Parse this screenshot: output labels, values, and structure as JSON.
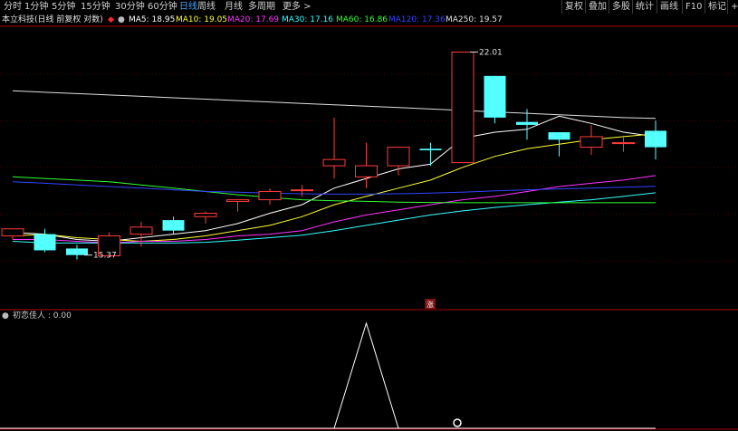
{
  "toolbar": {
    "timeframes": [
      {
        "label": "分时",
        "active": false
      },
      {
        "label": "1分钟",
        "active": false
      },
      {
        "label": "5分钟",
        "active": false
      },
      {
        "label": "15分钟",
        "active": false
      },
      {
        "label": "30分钟",
        "active": false
      },
      {
        "label": "60分钟",
        "active": false
      },
      {
        "label": "日线",
        "active": true
      },
      {
        "label": "周线",
        "active": false
      },
      {
        "label": "月线",
        "active": false
      },
      {
        "label": "多周期",
        "active": false
      },
      {
        "label": "更多",
        "active": false
      }
    ],
    "right_buttons": [
      "复权",
      "叠加",
      "多股",
      "统计",
      "画线",
      "F10",
      "标记",
      "+自"
    ]
  },
  "stock_title": "本立科技(日线 前复权 对数)",
  "ma_labels": [
    {
      "text": "MA5: 18.95",
      "color": "#ffffff"
    },
    {
      "text": "MA10: 19.05",
      "color": "#ffff33"
    },
    {
      "text": "MA20: 17.69",
      "color": "#ff33ff"
    },
    {
      "text": "MA30: 17.16",
      "color": "#33ffff"
    },
    {
      "text": "MA60: 16.86",
      "color": "#33ff33"
    },
    {
      "text": "MA120: 17.36",
      "color": "#3344ff"
    },
    {
      "text": "MA250: 19.57",
      "color": "#e0e0e0"
    }
  ],
  "colors": {
    "up": "#ff3b3b",
    "down": "#54ffff",
    "axis": "#aa0000",
    "grid": "#4a0000"
  },
  "chart_data": {
    "type": "candlestick",
    "scale": "log",
    "ylim": [
      14.0,
      23.0
    ],
    "candles": [
      {
        "o": 15.9,
        "h": 16.05,
        "l": 15.8,
        "c": 16.1
      },
      {
        "o": 15.95,
        "h": 16.1,
        "l": 15.45,
        "c": 15.5
      },
      {
        "o": 15.55,
        "h": 15.65,
        "l": 15.25,
        "c": 15.37
      },
      {
        "o": 15.35,
        "h": 16.0,
        "l": 15.3,
        "c": 15.9
      },
      {
        "o": 15.95,
        "h": 16.3,
        "l": 15.6,
        "c": 16.15
      },
      {
        "o": 16.35,
        "h": 16.45,
        "l": 15.95,
        "c": 16.05
      },
      {
        "o": 16.45,
        "h": 16.6,
        "l": 16.25,
        "c": 16.55
      },
      {
        "o": 16.9,
        "h": 16.95,
        "l": 16.6,
        "c": 16.95
      },
      {
        "o": 16.95,
        "h": 17.3,
        "l": 16.8,
        "c": 17.2
      },
      {
        "o": 17.25,
        "h": 17.4,
        "l": 17.05,
        "c": 17.25
      },
      {
        "o": 18.0,
        "h": 19.6,
        "l": 17.6,
        "c": 18.2
      },
      {
        "o": 17.65,
        "h": 18.75,
        "l": 17.3,
        "c": 18.0
      },
      {
        "o": 18.0,
        "h": 18.6,
        "l": 17.7,
        "c": 18.6
      },
      {
        "o": 18.55,
        "h": 18.75,
        "l": 18.0,
        "c": 18.5
      },
      {
        "o": 18.1,
        "h": 21.6,
        "l": 18.1,
        "c": 22.01
      },
      {
        "o": 21.1,
        "h": 21.1,
        "l": 19.4,
        "c": 19.6
      },
      {
        "o": 19.45,
        "h": 19.9,
        "l": 18.85,
        "c": 19.35
      },
      {
        "o": 19.1,
        "h": 19.1,
        "l": 18.3,
        "c": 18.85
      },
      {
        "o": 18.6,
        "h": 19.35,
        "l": 18.35,
        "c": 18.95
      },
      {
        "o": 18.75,
        "h": 18.95,
        "l": 18.45,
        "c": 18.75
      },
      {
        "o": 19.15,
        "h": 19.5,
        "l": 18.2,
        "c": 18.6
      }
    ],
    "ma": {
      "MA5": [
        16.0,
        15.95,
        15.8,
        15.75,
        15.85,
        15.95,
        16.05,
        16.25,
        16.55,
        16.8,
        17.3,
        17.6,
        17.9,
        18.05,
        18.9,
        19.1,
        19.2,
        19.65,
        19.4,
        19.1,
        18.95
      ],
      "MA10": [
        15.9,
        15.95,
        15.85,
        15.8,
        15.75,
        15.8,
        15.9,
        16.05,
        16.2,
        16.45,
        16.8,
        17.05,
        17.3,
        17.55,
        17.95,
        18.3,
        18.55,
        18.7,
        18.85,
        18.95,
        19.05
      ],
      "MA20": [
        15.8,
        15.8,
        15.75,
        15.7,
        15.75,
        15.75,
        15.8,
        15.9,
        15.95,
        16.05,
        16.3,
        16.5,
        16.65,
        16.8,
        16.95,
        17.05,
        17.2,
        17.35,
        17.45,
        17.55,
        17.69
      ],
      "MA30": [
        15.75,
        15.7,
        15.7,
        15.7,
        15.7,
        15.7,
        15.72,
        15.78,
        15.85,
        15.92,
        16.05,
        16.2,
        16.35,
        16.5,
        16.62,
        16.72,
        16.8,
        16.88,
        16.95,
        17.05,
        17.16
      ],
      "MA60": [
        17.65,
        17.6,
        17.55,
        17.5,
        17.4,
        17.3,
        17.2,
        17.1,
        17.02,
        16.95,
        16.92,
        16.9,
        16.88,
        16.87,
        16.86,
        16.86,
        16.86,
        16.86,
        16.86,
        16.86,
        16.86
      ],
      "MA120": [
        17.5,
        17.45,
        17.4,
        17.35,
        17.3,
        17.25,
        17.2,
        17.18,
        17.15,
        17.13,
        17.12,
        17.12,
        17.13,
        17.15,
        17.18,
        17.22,
        17.25,
        17.28,
        17.3,
        17.33,
        17.36
      ],
      "MA250": [
        20.55,
        20.5,
        20.45,
        20.4,
        20.35,
        20.3,
        20.25,
        20.2,
        20.15,
        20.1,
        20.05,
        20.0,
        19.95,
        19.9,
        19.85,
        19.8,
        19.75,
        19.7,
        19.65,
        19.6,
        19.57
      ]
    },
    "annotations": [
      {
        "text": "22.01",
        "index": 14,
        "price": 22.01
      },
      {
        "text": "15.37",
        "index": 2,
        "price": 15.37
      }
    ],
    "indicator": {
      "label": "初恋佳人 : 0.00",
      "values": [
        0,
        0,
        0,
        0,
        0,
        0,
        0,
        0,
        0,
        0,
        0,
        1,
        0,
        0,
        0,
        0,
        0,
        0,
        0,
        0,
        0
      ]
    }
  },
  "badges": {
    "limit_up": "涨"
  }
}
